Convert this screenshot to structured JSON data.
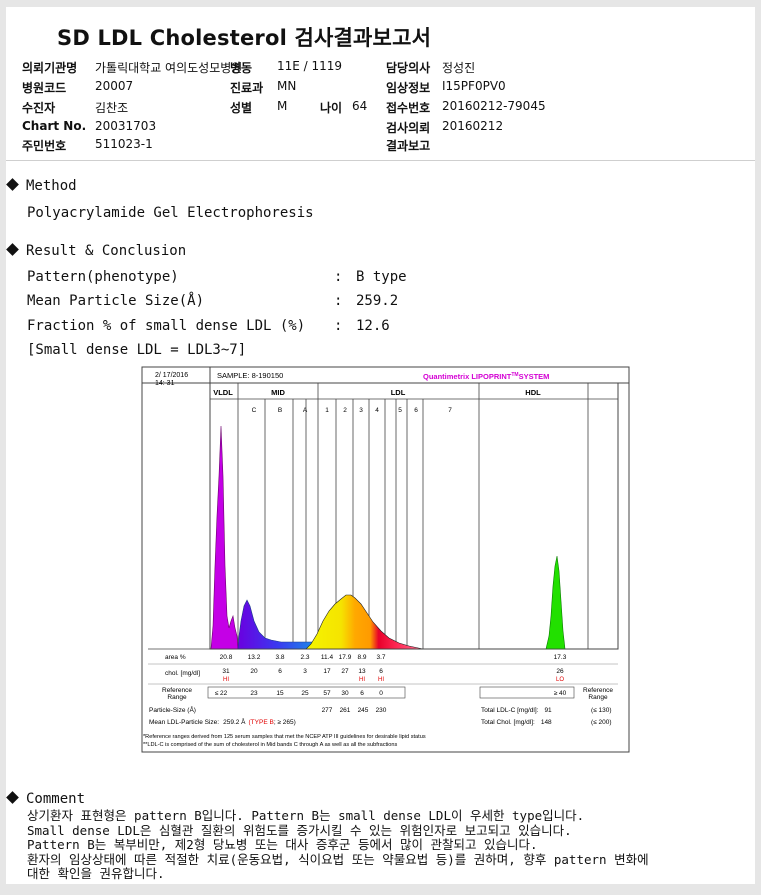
{
  "report": {
    "title": "SD LDL Cholesterol 검사결과보고서",
    "rows": [
      {
        "l1": "의뢰기관명",
        "v1": "가톨릭대학교 여의도성모병원",
        "l2": "병동",
        "v2": "11E / 1119",
        "l3": "담당의사",
        "v3": "정성진"
      },
      {
        "l1": "병원코드",
        "v1": "20007",
        "l2": "진료과",
        "v2": "MN",
        "l3": "임상정보",
        "v3": "I15PF0PV0"
      },
      {
        "l1": "수진자",
        "v1": "김찬조",
        "l2": "성별",
        "v2": "M",
        "l2b": "나이",
        "v2b": "64",
        "l3": "접수번호",
        "v3": "20160212-79045"
      },
      {
        "l1": "Chart No.",
        "v1": "20031703",
        "l3": "검사의뢰",
        "v3": "20160212"
      },
      {
        "l1": "주민번호",
        "v1": "511023-1",
        "l3": "결과보고",
        "v3": ""
      }
    ]
  },
  "method": {
    "heading": "Method",
    "text": "Polyacrylamide Gel Electrophoresis"
  },
  "result": {
    "heading": "Result & Conclusion",
    "items": [
      {
        "label": "Pattern(phenotype)",
        "value": "B type"
      },
      {
        "label": "Mean Particle Size(Å)",
        "value": "259.2"
      },
      {
        "label": "Fraction % of small dense LDL (%)",
        "value": "12.6"
      }
    ],
    "note": "[Small dense LDL = LDL3~7]"
  },
  "chart": {
    "date": "2/ 17/2016",
    "time": "14: 31",
    "sample": "SAMPLE:   8-190150",
    "brand": "Quantimetrix LIPOPRINT",
    "brand_tm": "TM",
    "brand_tail": "SYSTEM",
    "groups": {
      "vldl": "VLDL",
      "mid": "MID",
      "ldl": "LDL",
      "hdl": "HDL"
    },
    "bands": [
      "C",
      "B",
      "A",
      "1",
      "2",
      "3",
      "4",
      "5",
      "6",
      "7"
    ],
    "row_labels": {
      "area": "area %",
      "chol": "chol. [mg/dl]",
      "ref": "Reference Range"
    },
    "area": [
      "20.8",
      "13.2",
      "3.8",
      "2.3",
      "11.4",
      "17.9",
      "8.9",
      "3.7",
      "17.3"
    ],
    "chol": [
      "31",
      "20",
      "6",
      "3",
      "17",
      "27",
      "13",
      "6",
      "26"
    ],
    "flags": {
      "vldl": "HI",
      "ldl3": "HI",
      "ldl4": "HI",
      "hdl": "LO"
    },
    "ref": [
      "≤ 22",
      "23",
      "15",
      "25",
      "57",
      "30",
      "6",
      "0",
      "≥ 40"
    ],
    "particle_size_label": "Particle-Size (Å)",
    "particle_sizes": [
      "277",
      "261",
      "245",
      "230"
    ],
    "mean_label": "Mean LDL-Particle Size:",
    "mean_value": "259.2 Å",
    "type_b": "(TYPE B",
    "mean_ref": "; ≥ 265)",
    "total_ldlc_label": "Total LDL-C [mg/dl]:",
    "total_ldlc": "91",
    "total_ldlc_ref": "(≤ 130)",
    "total_chol_label": "Total Chol. [mg/dl]:",
    "total_chol": "148",
    "total_chol_ref": "(≤ 200)",
    "ref_side": "Reference Range",
    "foot1": "*Reference ranges derived from 125 serum samples that met the NCEP ATP III guidelines for desirable lipid status",
    "foot2": "**LDL-C is comprised of the sum of cholesterol in Mid bands C through A as well as all the subfractions",
    "colors": {
      "vldl": "#c400e6",
      "mid": "#6a00e0",
      "midblue": "#1a73e8",
      "ldl1": "#f2f200",
      "ldl2": "#ffa500",
      "ldl3": "#e8002a",
      "ldl4": "#ff3c6e",
      "hdl": "#22e000",
      "accent": "#d400d4",
      "flag": "#e00000"
    }
  },
  "comment": {
    "heading": "Comment",
    "lines": [
      "상기환자 표현형은 pattern B입니다. Pattern B는 small dense LDL이 우세한 type입니다.",
      "Small dense LDL은 심혈관 질환의 위험도를 증가시킬 수 있는 위험인자로 보고되고 있습니다.",
      "Pattern B는 복부비만, 제2형 당뇨병 또는 대사 증후군 등에서 많이 관찰되고 있습니다.",
      "환자의 임상상태에 따른 적절한 치료(운동요법, 식이요법 또는 약물요법 등)를 권하며, 향후 pattern 변화에",
      "대한 확인을 권유합니다."
    ]
  }
}
